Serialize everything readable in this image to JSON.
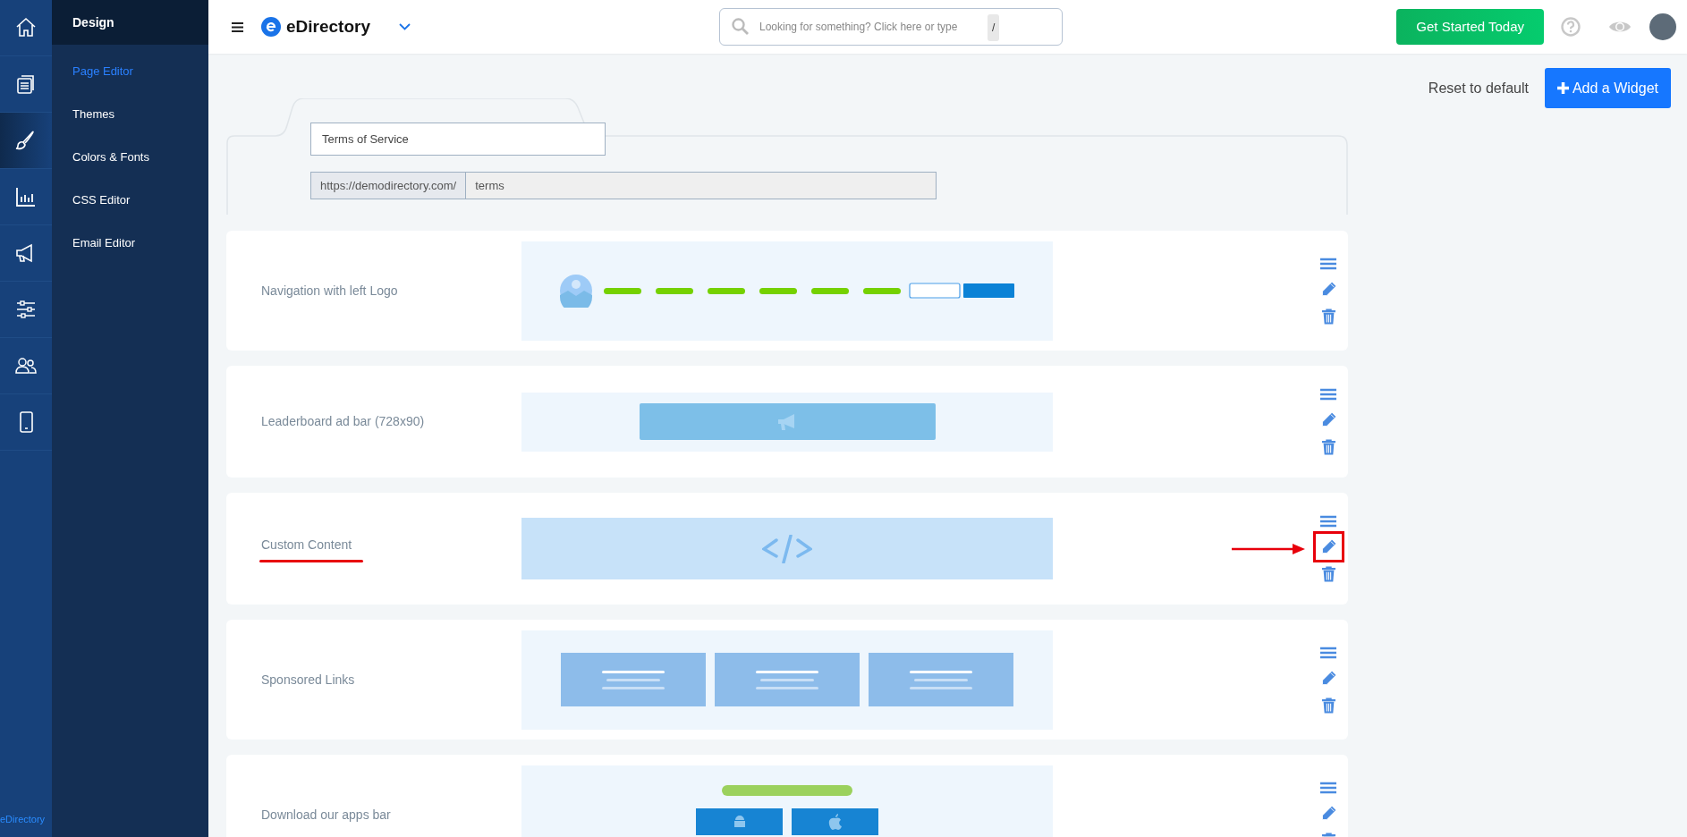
{
  "rail": [
    {
      "kind": "home",
      "selected": false
    },
    {
      "kind": "pages",
      "selected": false
    },
    {
      "kind": "brush",
      "selected": true
    },
    {
      "kind": "chart",
      "selected": false
    },
    {
      "kind": "megaphone",
      "selected": false
    },
    {
      "kind": "sliders",
      "selected": false
    },
    {
      "kind": "users",
      "selected": false
    },
    {
      "kind": "phone",
      "selected": false
    }
  ],
  "rail_footer": "eDirectory",
  "submenu": {
    "title": "Design",
    "items": [
      {
        "label": "Page Editor",
        "selected": true
      },
      {
        "label": "Themes",
        "selected": false
      },
      {
        "label": "Colors & Fonts",
        "selected": false
      },
      {
        "label": "CSS Editor",
        "selected": false
      },
      {
        "label": "Email Editor",
        "selected": false
      }
    ]
  },
  "topbar": {
    "logo": "eDirectory",
    "search": {
      "placeholder": "Looking for something? Click here or type",
      "shortcut": "/"
    },
    "cta": "Get Started Today"
  },
  "actions": {
    "reset": "Reset to default",
    "add": "Add a Widget"
  },
  "page": {
    "title": "Terms of Service",
    "url_prefix": "https://demodirectory.com/",
    "url_slug": "terms"
  },
  "widgets": [
    {
      "label": "Navigation with left Logo",
      "kind": "nav",
      "highlighted": false
    },
    {
      "label": "Leaderboard ad bar (728x90)",
      "kind": "ad",
      "highlighted": false
    },
    {
      "label": "Custom Content",
      "kind": "code",
      "highlighted": true
    },
    {
      "label": "Sponsored Links",
      "kind": "sponsored",
      "highlighted": false
    },
    {
      "label": "Download our apps bar",
      "kind": "apps",
      "highlighted": false
    }
  ]
}
